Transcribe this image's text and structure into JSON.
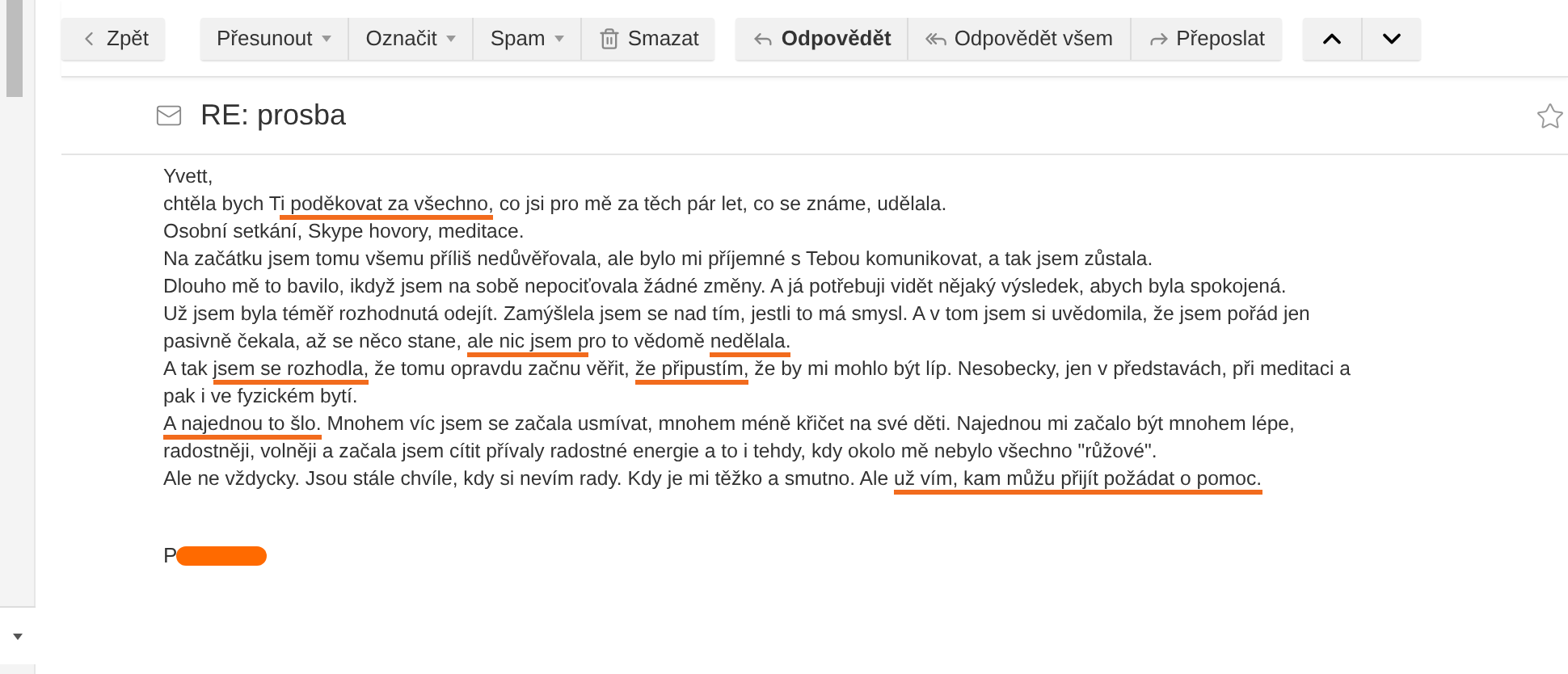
{
  "toolbar": [
    {
      "buttons": [
        {
          "label": "Zpět",
          "kind": "back",
          "dropdown": false,
          "primary": false
        }
      ]
    },
    {
      "buttons": [
        {
          "label": "Přesunout",
          "kind": "text",
          "dropdown": true,
          "primary": false
        },
        {
          "label": "Označit",
          "kind": "text",
          "dropdown": true,
          "primary": false
        },
        {
          "label": "Spam",
          "kind": "text",
          "dropdown": true,
          "primary": false
        },
        {
          "label": "Smazat",
          "kind": "trash",
          "dropdown": false,
          "primary": false
        }
      ]
    },
    {
      "buttons": [
        {
          "label": "Odpovědět",
          "kind": "reply",
          "dropdown": false,
          "primary": true
        },
        {
          "label": "Odpovědět všem",
          "kind": "reply-all",
          "dropdown": false,
          "primary": false
        },
        {
          "label": "Přeposlat",
          "kind": "forward",
          "dropdown": false,
          "primary": false
        }
      ]
    },
    {
      "buttons": [
        {
          "kind": "up",
          "dropdown": false,
          "primary": false
        },
        {
          "kind": "down",
          "dropdown": false,
          "primary": false
        }
      ]
    }
  ],
  "message": {
    "subject": "RE: prosba",
    "starred": false,
    "lines": [
      [
        {
          "text": "Yvett,",
          "underlined": false
        }
      ],
      [
        {
          "text": "chtěla bych T",
          "underlined": false
        },
        {
          "text": "i poděkovat za všechno,",
          "underlined": true
        },
        {
          "text": " co jsi pro mě za těch pár let, co se známe, udělala.",
          "underlined": false
        }
      ],
      [
        {
          "text": "Osobní setkání, Skype hovory, meditace.",
          "underlined": false
        }
      ],
      [
        {
          "text": "Na začátku jsem tomu všemu příliš nedůvěřovala, ale bylo mi příjemné s Tebou komunikovat, a tak jsem zůstala.",
          "underlined": false
        }
      ],
      [
        {
          "text": "Dlouho mě to bavilo, ikdyž jsem na sobě nepociťovala žádné změny. A já potřebuji vidět nějaký výsledek, abych byla spokojená.",
          "underlined": false
        }
      ],
      [
        {
          "text": "Už jsem byla téměř rozhodnutá odejít. Zamýšlela jsem se nad tím, jestli to má smysl. A v tom jsem si uvědomila, že jsem pořád jen",
          "underlined": false
        }
      ],
      [
        {
          "text": "pasivně čekala, až se něco stane, ",
          "underlined": false
        },
        {
          "text": "ale nic jsem p",
          "underlined": true
        },
        {
          "text": "ro to vědomě ",
          "underlined": false
        },
        {
          "text": "nedělala.",
          "underlined": true
        }
      ],
      [
        {
          "text": "A tak ",
          "underlined": false
        },
        {
          "text": "jsem se rozhodla,",
          "underlined": true
        },
        {
          "text": " že tomu opravdu začnu věřit, ",
          "underlined": false
        },
        {
          "text": "že připustím,",
          "underlined": true
        },
        {
          "text": " že by mi mohlo být líp. Nesobecky, jen v představách, při meditaci a",
          "underlined": false
        }
      ],
      [
        {
          "text": "pak i ve fyzickém bytí.",
          "underlined": false
        }
      ],
      [
        {
          "text": "A najednou to šlo.",
          "underlined": true
        },
        {
          "text": " Mnohem víc jsem se začala usmívat, mnohem méně křičet na své děti. Najednou mi začalo být mnohem lépe,",
          "underlined": false
        }
      ],
      [
        {
          "text": "radostněji, volněji a začala jsem cítit přívaly radostné energie a to i tehdy, kdy okolo mě nebylo všechno \"růžové\".",
          "underlined": false
        }
      ],
      [
        {
          "text": "Ale ne vždycky. Jsou stále chvíle, kdy si nevím rady. Kdy je mi těžko a smutno. Ale ",
          "underlined": false
        },
        {
          "text": "už vím, kam můžu přijít požádat o pomoc.",
          "underlined": true
        }
      ]
    ],
    "signature": {
      "text": "P",
      "redacted": true
    }
  }
}
